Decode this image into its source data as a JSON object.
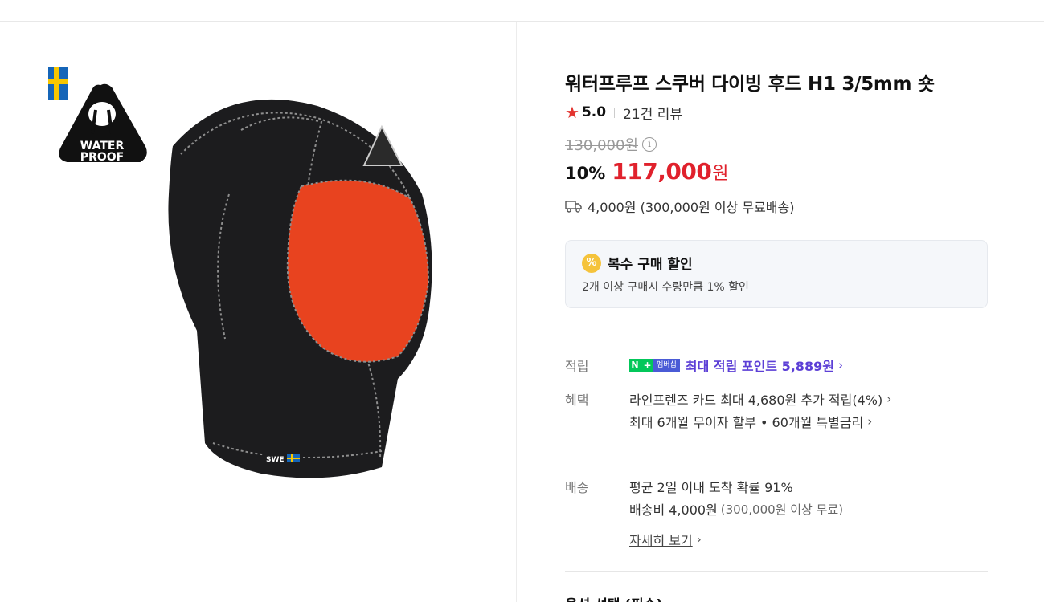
{
  "product": {
    "title": "워터프루프 스쿠버 다이빙 후드 H1 3/5mm 숏",
    "rating": "5.0",
    "review_count": "21건 리뷰",
    "original_price": "130,000원",
    "discount_rate": "10%",
    "sale_price": "117,000",
    "sale_unit": "원",
    "shipping_summary": "4,000원 (300,000원 이상 무료배송)"
  },
  "image": {
    "brand_line1": "WATER",
    "brand_line2": "PROOF",
    "brand_sub": "SWEDEN",
    "tag": "SWE"
  },
  "bulk_discount": {
    "badge": "%",
    "title": "복수 구매 할인",
    "description": "2개 이상 구매시 수량만큼 1% 할인"
  },
  "points": {
    "label": "적립",
    "badge_n": "N",
    "badge_plus": "+",
    "badge_member": "멤버십",
    "text": "최대 적립 포인트 5,889원"
  },
  "benefits": {
    "label": "혜택",
    "line1": "라인프렌즈 카드 최대 4,680원 추가 적립(4%)",
    "line2": "최대 6개월 무이자 할부 • 60개월 특별금리"
  },
  "delivery": {
    "label": "배송",
    "line1": "평균 2일 이내 도착 확률 91%",
    "line2": "배송비 4,000원",
    "line2_note": "(300,000원 이상 무료)",
    "detail_link": "자세히 보기"
  },
  "options": {
    "title": "옵션 선택 (필수)"
  },
  "colors": {
    "sale_red": "#e0212c",
    "point_purple": "#5c3fd6",
    "naver_green": "#03c75a",
    "hood_black": "#1c1c1e",
    "hood_lining": "#e8431f"
  }
}
